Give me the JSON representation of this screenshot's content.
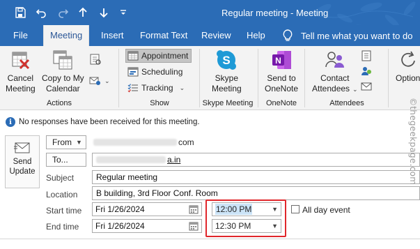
{
  "window": {
    "title": "Regular meeting  -  Meeting"
  },
  "tabs": [
    {
      "label": "File"
    },
    {
      "label": "Meeting",
      "active": true
    },
    {
      "label": "Insert"
    },
    {
      "label": "Format Text"
    },
    {
      "label": "Review"
    },
    {
      "label": "Help"
    }
  ],
  "tellme": {
    "label": "Tell me what you want to do"
  },
  "ribbon": {
    "actions": {
      "cancel_label_1": "Cancel",
      "cancel_label_2": "Meeting",
      "copy_label_1": "Copy to My",
      "copy_label_2": "Calendar",
      "group_label": "Actions"
    },
    "show": {
      "appointment": "Appointment",
      "scheduling": "Scheduling",
      "tracking": "Tracking",
      "group_label": "Show"
    },
    "skype": {
      "label_1": "Skype",
      "label_2": "Meeting",
      "group_label": "Skype Meeting"
    },
    "onenote": {
      "label_1": "Send to",
      "label_2": "OneNote",
      "group_label": "OneNote"
    },
    "attendees": {
      "label_1": "Contact",
      "label_2": "Attendees",
      "group_label": "Attendees"
    },
    "options": {
      "label": "Option"
    }
  },
  "infobar": {
    "text": "No responses have been received for this meeting."
  },
  "form": {
    "send_label_1": "Send",
    "send_label_2": "Update",
    "from_button": "From",
    "from_value_suffix": "com",
    "to_button": "To...",
    "to_value_suffix": "a.in",
    "subject_label": "Subject",
    "subject_value": "Regular meeting",
    "location_label": "Location",
    "location_value": "B building, 3rd Floor Conf. Room",
    "start_label": "Start time",
    "start_date": "Fri 1/26/2024",
    "start_time": "12:00 PM",
    "end_label": "End time",
    "end_date": "Fri 1/26/2024",
    "end_time": "12:30 PM",
    "all_day_label": "All day event"
  },
  "watermark": {
    "text": "©thegeekpage.com"
  },
  "colors": {
    "titlebar": "#2b6cb6",
    "ribbon": "#f3f3f3",
    "highlight": "#e0262b"
  }
}
